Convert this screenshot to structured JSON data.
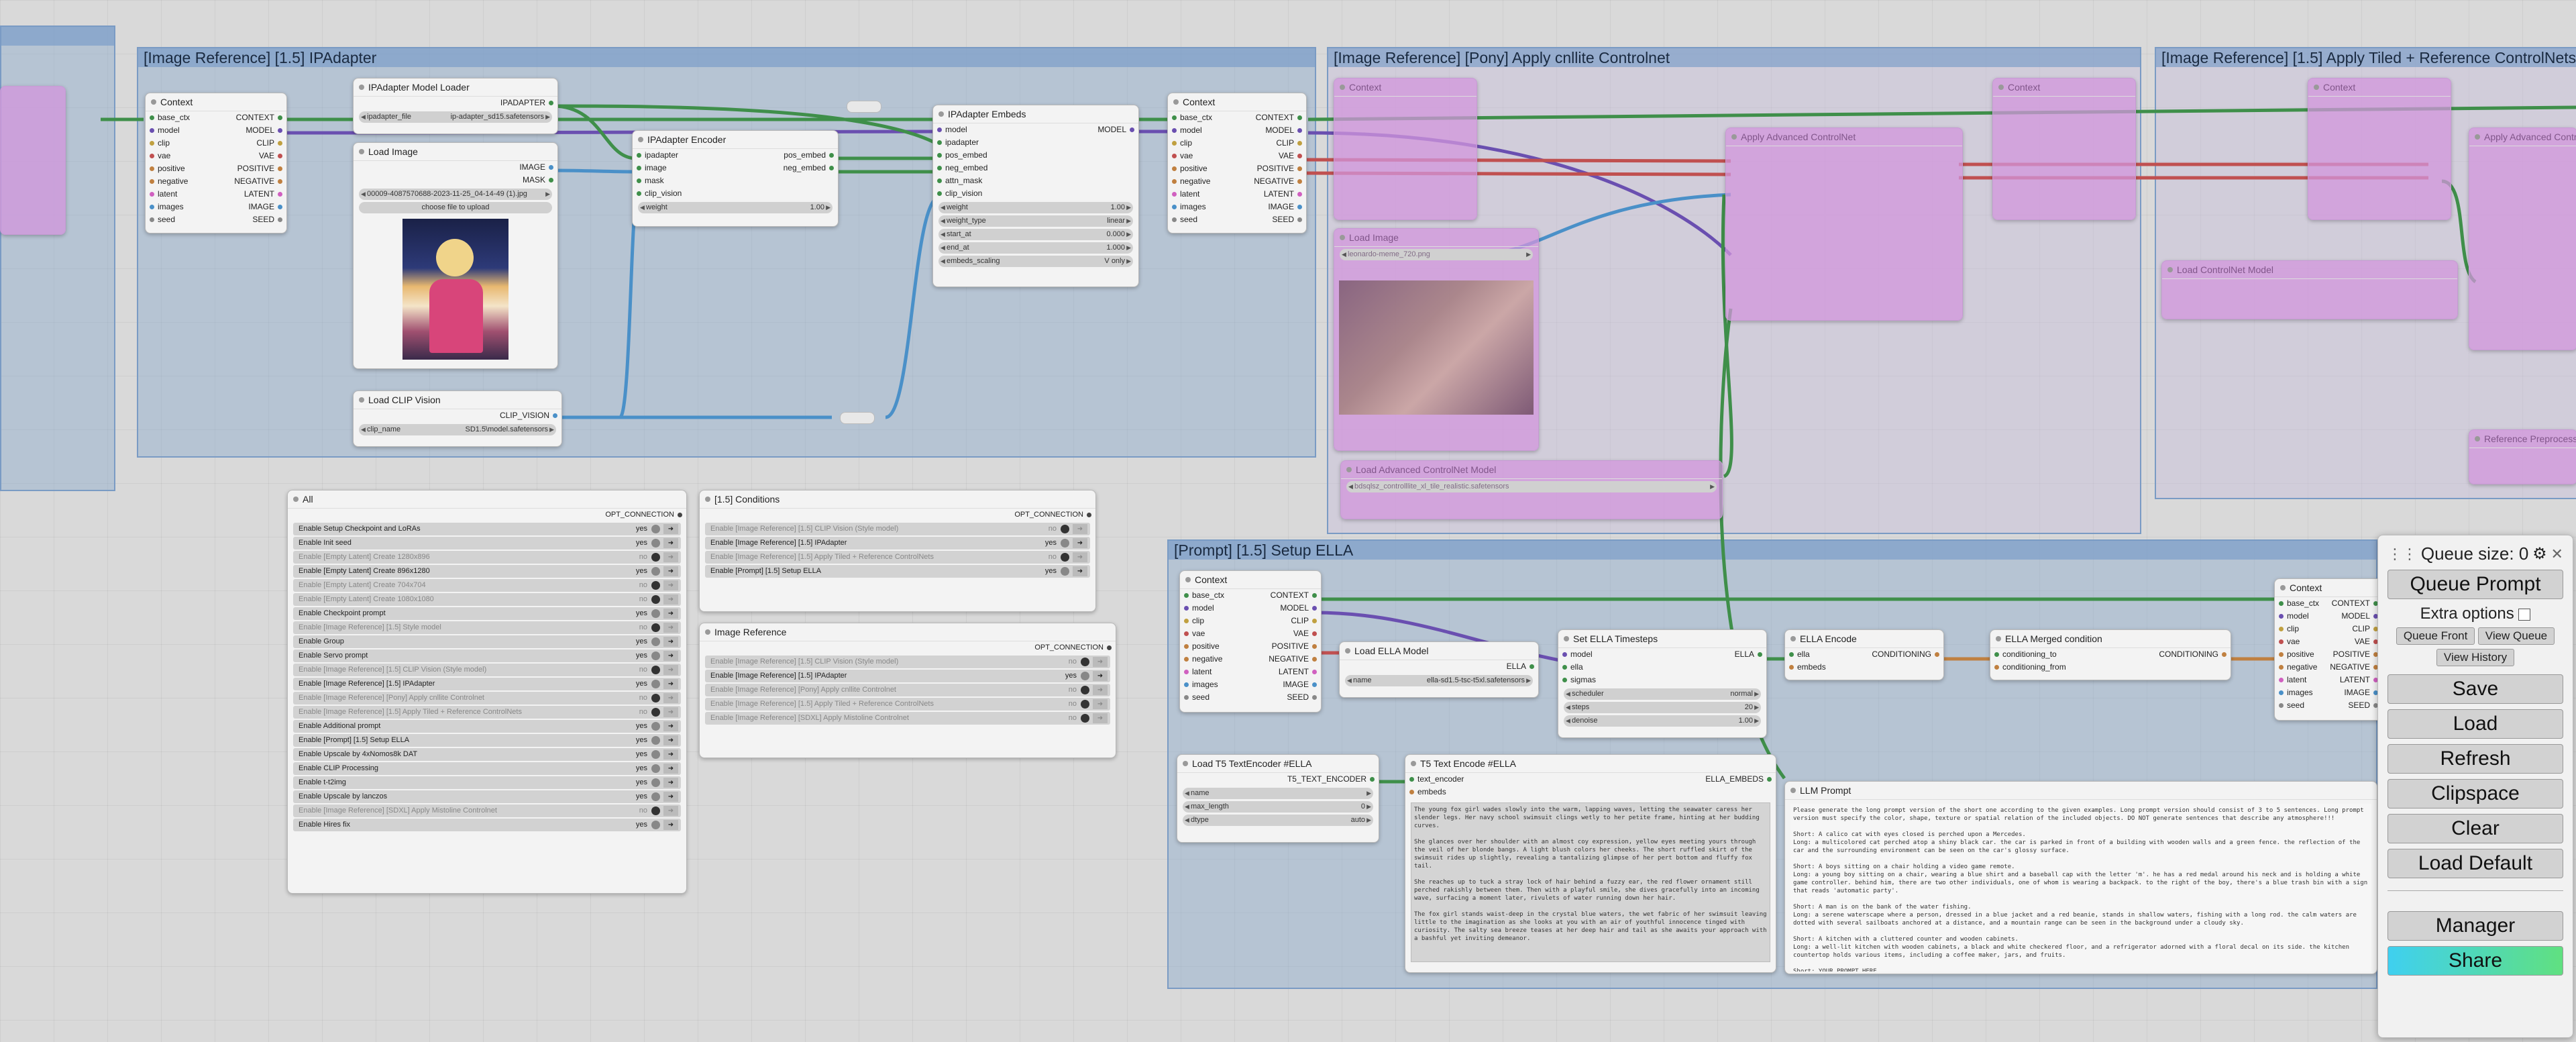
{
  "groups": {
    "ipadapter": "[Image Reference] [1.5] IPAdapter",
    "pony": "[Image Reference] [Pony] Apply cnllite Controlnet",
    "tiled": "[Image Reference] [1.5] Apply Tiled + Reference ControlNets",
    "ella": "[Prompt] [1.5] Setup ELLA"
  },
  "context_node": {
    "title": "Context",
    "rows": [
      {
        "in": "base_ctx",
        "out": "CONTEXT"
      },
      {
        "in": "model",
        "out": "MODEL"
      },
      {
        "in": "clip",
        "out": "CLIP"
      },
      {
        "in": "vae",
        "out": "VAE"
      },
      {
        "in": "positive",
        "out": "POSITIVE"
      },
      {
        "in": "negative",
        "out": "NEGATIVE"
      },
      {
        "in": "latent",
        "out": "LATENT"
      },
      {
        "in": "images",
        "out": "IMAGE"
      },
      {
        "in": "seed",
        "out": "SEED"
      }
    ]
  },
  "ipadapter_loader": {
    "title": "IPAdapter Model Loader",
    "out": "IPADAPTER",
    "widget_name": "ipadapter_file",
    "widget_value": "ip-adapter_sd15.safetensors"
  },
  "load_image": {
    "title": "Load Image",
    "out1": "IMAGE",
    "out2": "MASK",
    "widget_value": "00009-4087570688-2023-11-25_04-14-49 (1).jpg",
    "upload": "choose file to upload"
  },
  "load_clip_vision": {
    "title": "Load CLIP Vision",
    "out": "CLIP_VISION",
    "widget_name": "clip_name",
    "widget_value": "SD1.5\\model.safetensors"
  },
  "ipadapter_encoder": {
    "title": "IPAdapter Encoder",
    "rows": [
      {
        "in": "ipadapter",
        "out": "pos_embed"
      },
      {
        "in": "image",
        "out": "neg_embed"
      },
      {
        "in": "mask",
        "out": ""
      },
      {
        "in": "clip_vision",
        "out": ""
      }
    ],
    "widget_name": "weight",
    "widget_value": "1.00"
  },
  "ipadapter_embeds": {
    "title": "IPAdapter Embeds",
    "inputs": [
      "model",
      "ipadapter",
      "pos_embed",
      "neg_embed",
      "attn_mask",
      "clip_vision"
    ],
    "out": "MODEL",
    "widgets": [
      {
        "name": "weight",
        "value": "1.00"
      },
      {
        "name": "weight_type",
        "value": "linear"
      },
      {
        "name": "start_at",
        "value": "0.000"
      },
      {
        "name": "end_at",
        "value": "1.000"
      },
      {
        "name": "embeds_scaling",
        "value": "V only"
      }
    ]
  },
  "all_panel": {
    "title": "All",
    "opt": "OPT_CONNECTION",
    "items": [
      {
        "label": "Enable Setup Checkpoint and LoRAs",
        "value": "yes"
      },
      {
        "label": "Enable Init seed",
        "value": "yes"
      },
      {
        "label": "Enable [Empty Latent] Create 1280x896",
        "value": "no"
      },
      {
        "label": "Enable [Empty Latent] Create 896x1280",
        "value": "yes"
      },
      {
        "label": "Enable [Empty Latent] Create 704x704",
        "value": "no"
      },
      {
        "label": "Enable [Empty Latent] Create 1080x1080",
        "value": "no"
      },
      {
        "label": "Enable Checkpoint prompt",
        "value": "yes"
      },
      {
        "label": "Enable [Image Reference] [1.5] Style model",
        "value": "no"
      },
      {
        "label": "Enable Group",
        "value": "yes"
      },
      {
        "label": "Enable Servo prompt",
        "value": "yes"
      },
      {
        "label": "Enable [Image Reference] [1.5] CLIP Vision (Style model)",
        "value": "no"
      },
      {
        "label": "Enable [Image Reference] [1.5] IPAdapter",
        "value": "yes"
      },
      {
        "label": "Enable [Image Reference] [Pony] Apply cnllite Controlnet",
        "value": "no"
      },
      {
        "label": "Enable [Image Reference] [1.5] Apply Tiled + Reference ControlNets",
        "value": "no"
      },
      {
        "label": "Enable Additional prompt",
        "value": "yes"
      },
      {
        "label": "Enable [Prompt] [1.5] Setup ELLA",
        "value": "yes"
      },
      {
        "label": "Enable Upscale by 4xNomos8k DAT",
        "value": "yes"
      },
      {
        "label": "Enable CLIP Processing",
        "value": "yes"
      },
      {
        "label": "Enable t-t2img",
        "value": "yes"
      },
      {
        "label": "Enable Upscale by lanczos",
        "value": "yes"
      },
      {
        "label": "Enable [Image Reference] [SDXL] Apply Mistoline Controlnet",
        "value": "no"
      },
      {
        "label": "Enable Hires fix",
        "value": "yes"
      }
    ]
  },
  "conditions_panel": {
    "title": "[1.5] Conditions",
    "opt": "OPT_CONNECTION",
    "items": [
      {
        "label": "Enable [Image Reference] [1.5] CLIP Vision (Style model)",
        "value": "no"
      },
      {
        "label": "Enable [Image Reference] [1.5] IPAdapter",
        "value": "yes"
      },
      {
        "label": "Enable [Image Reference] [1.5] Apply Tiled + Reference ControlNets",
        "value": "no"
      },
      {
        "label": "Enable [Prompt] [1.5] Setup ELLA",
        "value": "yes"
      }
    ]
  },
  "imageref_panel": {
    "title": "Image Reference",
    "opt": "OPT_CONNECTION",
    "items": [
      {
        "label": "Enable [Image Reference] [1.5] CLIP Vision (Style model)",
        "value": "no"
      },
      {
        "label": "Enable [Image Reference] [1.5] IPAdapter",
        "value": "yes"
      },
      {
        "label": "Enable [Image Reference] [Pony] Apply cnllite Controlnet",
        "value": "no"
      },
      {
        "label": "Enable [Image Reference] [1.5] Apply Tiled + Reference ControlNets",
        "value": "no"
      },
      {
        "label": "Enable [Image Reference] [SDXL] Apply Mistoline Controlnet",
        "value": "no"
      }
    ]
  },
  "pony_nodes": {
    "context": "Context",
    "controlnet": "Apply Advanced ControlNet",
    "load_image": "Load Image",
    "load_image_value": "leonardo-meme_720.png",
    "load_cn": "Load Advanced ControlNet Model",
    "load_cn_value": "bdsqlsz_controlllite_xl_tile_realistic.safetensors"
  },
  "tiled_nodes": {
    "context": "Context",
    "controlnet": "Apply Advanced ControlNet",
    "load_cn": "Load ControlNet Model",
    "reference": "Reference Preprocessor"
  },
  "ella": {
    "load_model": {
      "title": "Load ELLA Model",
      "out": "ELLA",
      "widget_name": "name",
      "widget_value": "ella-sd1.5-tsc-t5xl.safetensors"
    },
    "timesteps": {
      "title": "Set ELLA Timesteps",
      "inputs": [
        "model",
        "ella",
        "sigmas"
      ],
      "out": "ELLA",
      "widgets": [
        {
          "name": "scheduler",
          "value": "normal"
        },
        {
          "name": "steps",
          "value": "20"
        },
        {
          "name": "denoise",
          "value": "1.00"
        }
      ]
    },
    "encode": {
      "title": "ELLA Encode",
      "inputs": [
        "ella",
        "embeds"
      ],
      "out": "CONDITIONING"
    },
    "merged": {
      "title": "ELLA Merged condition",
      "inputs": [
        "conditioning_to",
        "conditioning_from"
      ],
      "out": "CONDITIONING"
    },
    "t5_loader": {
      "title": "Load T5 TextEncoder #ELLA",
      "out": "T5_TEXT_ENCODER",
      "widgets": [
        {
          "name": "name",
          "value": ""
        },
        {
          "name": "max_length",
          "value": "0"
        },
        {
          "name": "dtype",
          "value": "auto"
        }
      ]
    },
    "t5_encode": {
      "title": "T5 Text Encode #ELLA",
      "inputs": [
        "text_encoder",
        "embeds"
      ],
      "out": "ELLA_EMBEDS",
      "text": "The young fox girl wades slowly into the warm, lapping waves, letting the seawater caress her slender legs. Her navy school swimsuit clings wetly to her petite frame, hinting at her budding curves.\n\nShe glances over her shoulder with an almost coy expression, yellow eyes meeting yours through the veil of her blonde bangs. A light blush colors her cheeks. The short ruffled skirt of the swimsuit rides up slightly, revealing a tantalizing glimpse of her pert bottom and fluffy fox tail.\n\nShe reaches up to tuck a stray lock of hair behind a fuzzy ear, the red flower ornament still perched rakishly between them. Then with a playful smile, she dives gracefully into an incoming wave, surfacing a moment later, rivulets of water running down her hair.\n\nThe fox girl stands waist-deep in the crystal blue waters, the wet fabric of her swimsuit leaving little to the imagination as she looks at you with an air of youthful innocence tinged with curiosity. The salty sea breeze teases at her deep hair and tail as she awaits your approach with a bashful yet inviting demeanor."
    },
    "llm": {
      "title": "LLM Prompt",
      "text": "Please generate the long prompt version of the short one according to the given examples. Long prompt version should consist of 3 to 5 sentences. Long prompt version must specify the color, shape, texture or spatial relation of the included objects. DO NOT generate sentences that describe any atmosphere!!!\n\nShort: A calico cat with eyes closed is perched upon a Mercedes.\nLong: a multicolored cat perched atop a shiny black car. the car is parked in front of a building with wooden walls and a green fence. the reflection of the car and the surrounding environment can be seen on the car's glossy surface.\n\nShort: A boys sitting on a chair holding a video game remote.\nLong: a young boy sitting on a chair, wearing a blue shirt and a baseball cap with the letter 'm'. he has a red medal around his neck and is holding a white game controller. behind him, there are two other individuals, one of whom is wearing a backpack. to the right of the boy, there's a blue trash bin with a sign that reads 'automatic party'.\n\nShort: A man is on the bank of the water fishing.\nLong: a serene waterscape where a person, dressed in a blue jacket and a red beanie, stands in shallow waters, fishing with a long rod. the calm waters are dotted with several sailboats anchored at a distance, and a mountain range can be seen in the background under a cloudy sky.\n\nShort: A kitchen with a cluttered counter and wooden cabinets.\nLong: a well-lit kitchen with wooden cabinets, a black and white checkered floor, and a refrigerator adorned with a floral decal on its side. the kitchen countertop holds various items, including a coffee maker, jars, and fruits.\n\nShort: YOUR_PROMPT_HERE"
    }
  },
  "menu": {
    "queue_size": "Queue size: 0",
    "queue_prompt": "Queue Prompt",
    "extra_options": "Extra options",
    "queue_front": "Queue Front",
    "view_queue": "View Queue",
    "view_history": "View History",
    "save": "Save",
    "load": "Load",
    "refresh": "Refresh",
    "clipspace": "Clipspace",
    "clear": "Clear",
    "load_default": "Load Default",
    "manager": "Manager",
    "share": "Share"
  },
  "colors": {
    "wire_green": "#3f8f4a",
    "wire_purple": "#6a4fb0",
    "wire_blue": "#4a90c8",
    "wire_red": "#c05050",
    "wire_orange": "#c08040",
    "group_blue": "#7a9bc4",
    "share_gradient_a": "#3fd0f0",
    "share_gradient_b": "#60e080"
  }
}
